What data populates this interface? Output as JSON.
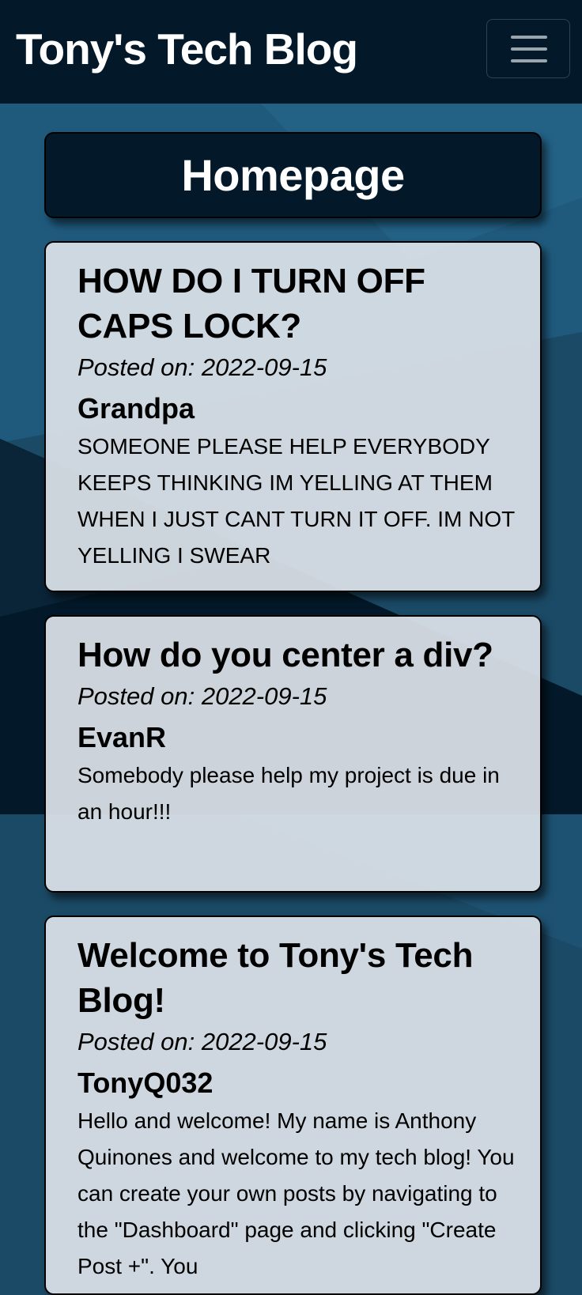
{
  "navbar": {
    "brand": "Tony's Tech Blog",
    "menu_icon": "hamburger-menu-icon"
  },
  "page": {
    "title": "Homepage"
  },
  "posts": [
    {
      "title": "HOW DO I TURN OFF CAPS LOCK?",
      "date": "Posted on: 2022-09-15",
      "author": "Grandpa",
      "body": "SOMEONE PLEASE HELP EVERYBODY KEEPS THINKING IM YELLING AT THEM WHEN I JUST CANT TURN IT OFF. IM NOT YELLING I SWEAR"
    },
    {
      "title": "How do you center a div?",
      "date": "Posted on: 2022-09-15",
      "author": "EvanR",
      "body": "Somebody please help my project is due in an hour!!!"
    },
    {
      "title": "Welcome to Tony's Tech Blog!",
      "date": "Posted on: 2022-09-15",
      "author": "TonyQ032",
      "body": "Hello and welcome! My name is Anthony Quinones and welcome to my tech blog! You can create your own posts by navigating to the \"Dashboard\" page and clicking \"Create Post +\". You"
    }
  ],
  "colors": {
    "navbar": "#03192a",
    "background": "#1b4a66",
    "card": "#dce2e8"
  }
}
